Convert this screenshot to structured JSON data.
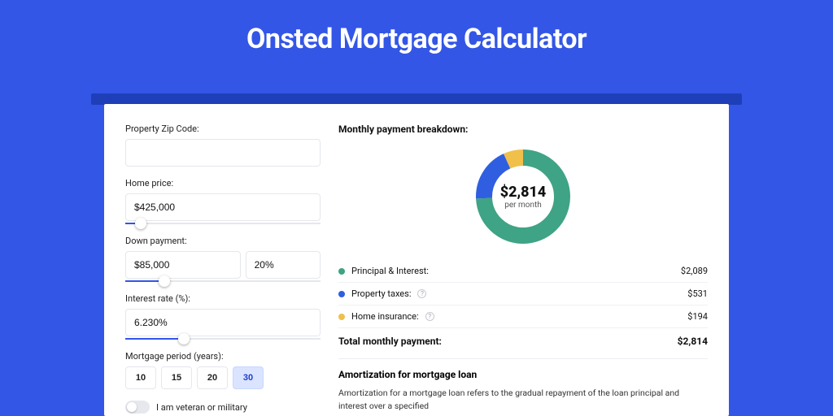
{
  "title": "Onsted Mortgage Calculator",
  "left": {
    "zip": {
      "label": "Property Zip Code:",
      "value": ""
    },
    "home_price": {
      "label": "Home price:",
      "value": "$425,000",
      "slider_pct": 8
    },
    "down_payment": {
      "label": "Down payment:",
      "amount": "$85,000",
      "percent": "20%",
      "slider_pct": 20
    },
    "interest_rate": {
      "label": "Interest rate (%):",
      "value": "6.230%",
      "slider_pct": 30
    },
    "period": {
      "label": "Mortgage period (years):",
      "options": [
        "10",
        "15",
        "20",
        "30"
      ],
      "active_index": 3
    },
    "veteran": {
      "label": "I am veteran or military",
      "checked": false
    }
  },
  "right": {
    "breakdown_title": "Monthly payment breakdown:",
    "center_amount": "$2,814",
    "center_sub": "per month",
    "legend": {
      "pi": {
        "label": "Principal & Interest:",
        "value": "$2,089",
        "color": "#3fa385"
      },
      "taxes": {
        "label": "Property taxes:",
        "value": "$531",
        "color": "#2f5fe0"
      },
      "ins": {
        "label": "Home insurance:",
        "value": "$194",
        "color": "#f0c04b"
      }
    },
    "total": {
      "label": "Total monthly payment:",
      "value": "$2,814"
    },
    "amort": {
      "title": "Amortization for mortgage loan",
      "text": "Amortization for a mortgage loan refers to the gradual repayment of the loan principal and interest over a specified"
    }
  },
  "chart_data": {
    "type": "pie",
    "title": "Monthly payment breakdown",
    "series": [
      {
        "name": "Principal & Interest",
        "value": 2089,
        "color": "#3fa385"
      },
      {
        "name": "Property taxes",
        "value": 531,
        "color": "#2f5fe0"
      },
      {
        "name": "Home insurance",
        "value": 194,
        "color": "#f0c04b"
      }
    ],
    "total": 2814,
    "center_label": "$2,814 per month"
  }
}
